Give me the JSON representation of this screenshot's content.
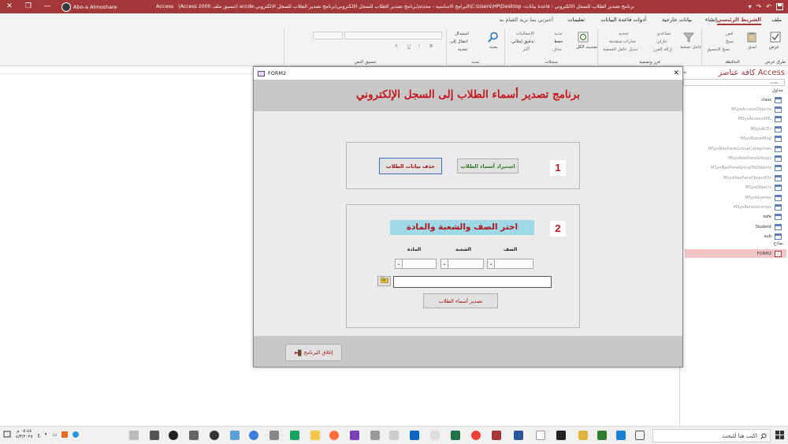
{
  "window": {
    "title": "برنامج تصدير الطلاب للسجل الالكتروني : قاعدة بيانات- C:\\Users\\HP\\Desktop\\البرامج الاساسية - محدثة\\برنامج تصدير الطلاب للسجل الالكتروني\\برنامج تصدير الطلاب للسجل الالكتروني.accde (تنسيق ملف Access 2000)",
    "app_name": "Access",
    "user": "Abo-a Almoshare",
    "controls": {
      "close": "✕",
      "maximize": "❐",
      "minimize": "—"
    },
    "qat": [
      "↶",
      "↷",
      "▾"
    ]
  },
  "ribbon_tabs": {
    "file": "ملف",
    "home": "الشريط الرئيسي",
    "create": "إنشاء",
    "external": "بيانات خارجية",
    "dbtools": "أدوات قاعدة البيانات",
    "help": "تعليمات",
    "tellme": "أخبرني بما تريد القيام به"
  },
  "ribbon": {
    "views": {
      "label": "طرق عرض",
      "button": "عرض"
    },
    "clipboard": {
      "label": "الحافظة",
      "paste": "لصق",
      "cut": "قص",
      "copy": "نسخ",
      "format": "نسخ التنسيق"
    },
    "sort": {
      "label": "فرز وتصفية",
      "filter": "عامل تصفية",
      "asc": "تصاعدي",
      "desc": "تنازلي",
      "remove": "إزالة الفرز",
      "selection": "تحديد",
      "advanced": "خيارات متقدمة",
      "toggle": "تبديل عامل التصفية"
    },
    "records": {
      "label": "سجلات",
      "refresh": "تحديث الكل",
      "new": "جديد",
      "save": "حفظ",
      "delete": "حذف",
      "totals": "الإجماليات",
      "spell": "تدقيق إملائي",
      "more": "أكثر"
    },
    "find": {
      "label": "بحث",
      "find": "بحث",
      "replace": "استبدال",
      "goto": "انتقال إلى",
      "select": "تحديد"
    },
    "text": {
      "label": "تنسيق النص",
      "bold": "B",
      "italic": "I",
      "underline": "U",
      "color": "A"
    }
  },
  "nav": {
    "title": "كافة عناصر Access",
    "search_placeholder": "بحث...",
    "tables_header": "جداول",
    "forms_header": "نماذج",
    "tables": [
      "class",
      "MSysAccessObjects",
      "MSysAccessXML",
      "MSysACEs",
      "MSysNameMap",
      "MSysNavPaneGroupCategories",
      "MSysNavPaneGroups",
      "MSysNavPaneGroupToObjects",
      "MSysNavPaneObjectIDs",
      "MSysObjects",
      "MSysQueries",
      "MSysRelationships",
      "safe",
      "Student",
      "sub"
    ],
    "forms": [
      "FORM2"
    ]
  },
  "form": {
    "tab_name": "FORM2",
    "close_x": "✕",
    "header_title": "برنامج تصدير أسماء الطلاب إلى السجل الإلكتروني",
    "section1": {
      "number": "1",
      "import_button": "استيراد أسماء الطلاب",
      "delete_button": "حذف بيانات الطلاب"
    },
    "section2": {
      "number": "2",
      "banner": "اختر الصف والشعبة والمادة",
      "class_label": "الصف",
      "division_label": "الشعبة",
      "subject_label": "المادة",
      "class_value": "",
      "division_value": "",
      "subject_value": "",
      "path_value": "",
      "export_button": "تصدير أسماء الطلاب"
    },
    "close_program_button": "إغلاق البرنامج"
  },
  "taskbar": {
    "search_placeholder": "اكتب هنا للبحث",
    "time": "٠٥:٤٨ م",
    "date": "٤/٣/٢٠٢٥",
    "lang": "ع"
  },
  "colors": {
    "accent": "#a4373a",
    "title_red": "#c4161c",
    "cyan_banner": "#9fd8e6",
    "form_body": "#ebebeb",
    "form_header": "#c8c8c8"
  }
}
